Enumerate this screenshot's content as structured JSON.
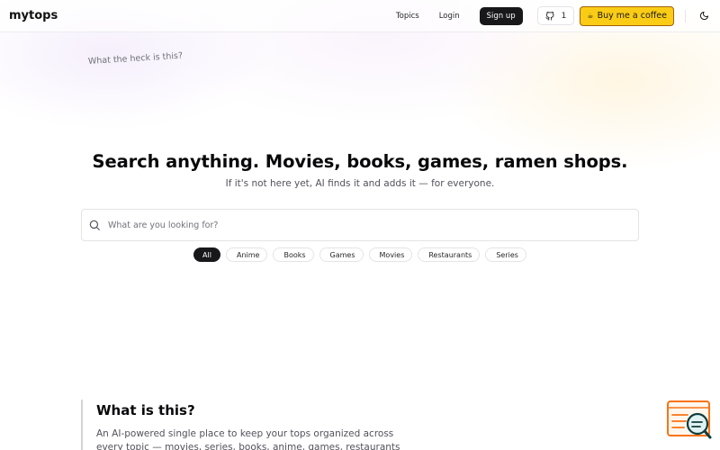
{
  "header": {
    "logo": "mytops",
    "nav": {
      "topics": "Topics",
      "login": "Login",
      "signup": "Sign up"
    },
    "star_count": "1",
    "coffee_label": "Buy me a coffee",
    "theme_icon": "moon-icon"
  },
  "note": "What the heck is this?",
  "hero": {
    "title": "Search anything. Movies, books, games, ramen shops.",
    "subtitle": "If it's not here yet, AI finds it and adds it — for everyone."
  },
  "search": {
    "placeholder": "What are you looking for?",
    "value": ""
  },
  "filters": [
    {
      "label": "All",
      "active": true
    },
    {
      "label": "Anime",
      "icon": ""
    },
    {
      "label": "Books",
      "icon": ""
    },
    {
      "label": "Games",
      "icon": ""
    },
    {
      "label": "Movies",
      "icon": ""
    },
    {
      "label": "Restaurants",
      "icon": ""
    },
    {
      "label": "Series",
      "icon": ""
    }
  ],
  "about": {
    "title": "What is this?",
    "body": "An AI-powered single place to keep your tops organized across every topic — movies, series, books, anime, games, restaurants —"
  },
  "colors": {
    "coffee": "#facc15",
    "primary": "#18181b",
    "widget": "#f97316"
  }
}
